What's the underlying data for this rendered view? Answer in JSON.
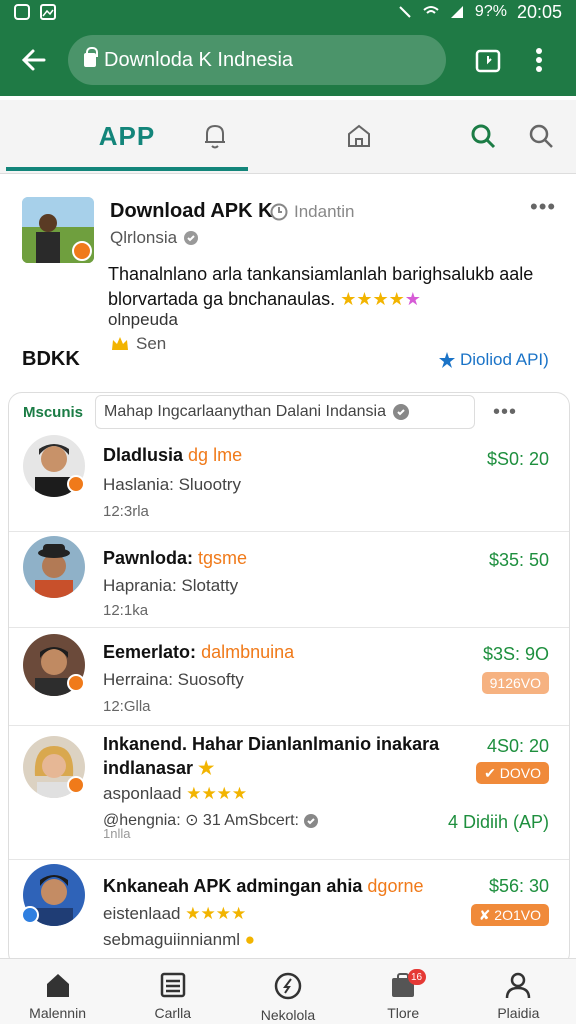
{
  "status_bar": {
    "battery": "9?%",
    "time": "20:05"
  },
  "browser": {
    "url": "Downloda K Indnesia"
  },
  "tabs": {
    "app": "APP"
  },
  "featured": {
    "title": "Download APK K",
    "meta": "Indantin",
    "subtitle": "Qlrlonsia",
    "description": "Thanalnlano arla tankansiamlanlah barighsalukb aale blorvartada ga bnchanaulas.",
    "stars": "★★★★",
    "star_pink": "★",
    "extra": "olnpeuda",
    "badge_text": "Sen",
    "brand": "BDKK",
    "link": "Dioliod API)"
  },
  "list": {
    "label": "Mscunis",
    "search_text": "Mahap Ingcarlaanythan Dalani Indansia",
    "items": [
      {
        "title": "Dladlusia",
        "highlight": "dg lme",
        "sub": "Haslania: Sluootry",
        "size": "12:3rla",
        "price": "$S0: 20"
      },
      {
        "title": "Pawnloda:",
        "highlight": "tgsme",
        "sub": "Haprania: Slotatty",
        "size": "12:1ka",
        "price": "$35: 50"
      },
      {
        "title": "Eemerlato:",
        "highlight": "dalmbnuina",
        "sub": "Herraina: Suosofty",
        "size": "12:Glla",
        "price": "$3S: 9O",
        "badge": "9126VO"
      },
      {
        "title": "Inkanend. Hahar Dianlanlmanio inakara",
        "title2": "indlanasar",
        "sub": "asponlaad",
        "meta": "@hengnia: ⊙ 31 AmSbcert:",
        "size": "1nlla",
        "price": "4S0: 20",
        "badge": "✔ DOVO",
        "link": "4 Didiih (AP)"
      },
      {
        "title": "Knkaneah APK admingan ahia",
        "highlight": "dgorne",
        "sub": "eistenlaad",
        "meta": "sebmaguiinnianml",
        "price": "$56: 30",
        "badge": "✘ 2O1VO"
      }
    ]
  },
  "bottom_nav": [
    {
      "label": "Malennin"
    },
    {
      "label": "Carlla"
    },
    {
      "label": "Nekolola"
    },
    {
      "label": "Tlore",
      "count": "16"
    },
    {
      "label": "Plaidia"
    }
  ]
}
